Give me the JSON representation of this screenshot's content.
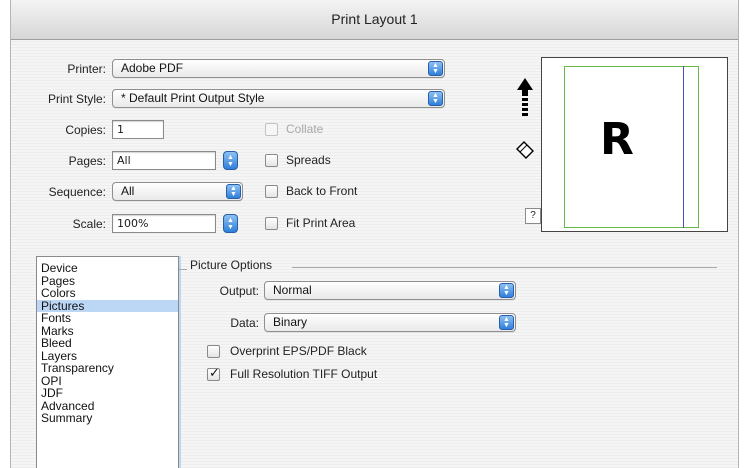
{
  "window": {
    "title": "Print Layout 1"
  },
  "form": {
    "printer_label": "Printer:",
    "printer_value": "Adobe PDF",
    "print_style_label": "Print Style:",
    "print_style_value": "* Default Print Output Style",
    "copies_label": "Copies:",
    "copies_value": "1",
    "pages_label": "Pages:",
    "pages_value": "All",
    "sequence_label": "Sequence:",
    "sequence_value": "All",
    "scale_label": "Scale:",
    "scale_value": "100%"
  },
  "checkboxes": {
    "collate": {
      "label": "Collate",
      "checked": false,
      "enabled": false
    },
    "spreads": {
      "label": "Spreads",
      "checked": false,
      "enabled": true
    },
    "back_to_front": {
      "label": "Back to Front",
      "checked": false,
      "enabled": true
    },
    "fit_print_area": {
      "label": "Fit Print Area",
      "checked": false,
      "enabled": true
    }
  },
  "preview": {
    "letter": "R",
    "help": "?"
  },
  "sidebar": {
    "items": [
      "Device",
      "Pages",
      "Colors",
      "Pictures",
      "Fonts",
      "Marks",
      "Bleed",
      "Layers",
      "Transparency",
      "OPI",
      "JDF",
      "Advanced",
      "Summary"
    ],
    "selected": "Pictures"
  },
  "picture_options": {
    "title": "Picture Options",
    "output_label": "Output:",
    "output_value": "Normal",
    "data_label": "Data:",
    "data_value": "Binary",
    "overprint": {
      "label": "Overprint EPS/PDF Black",
      "checked": false
    },
    "full_res": {
      "label": "Full Resolution TIFF Output",
      "checked": true
    }
  },
  "colors": {
    "accent_blue": "#2f7fdc",
    "selection": "#bcd7f5",
    "page_border": "#67b845",
    "margin_line": "#4553b8"
  }
}
